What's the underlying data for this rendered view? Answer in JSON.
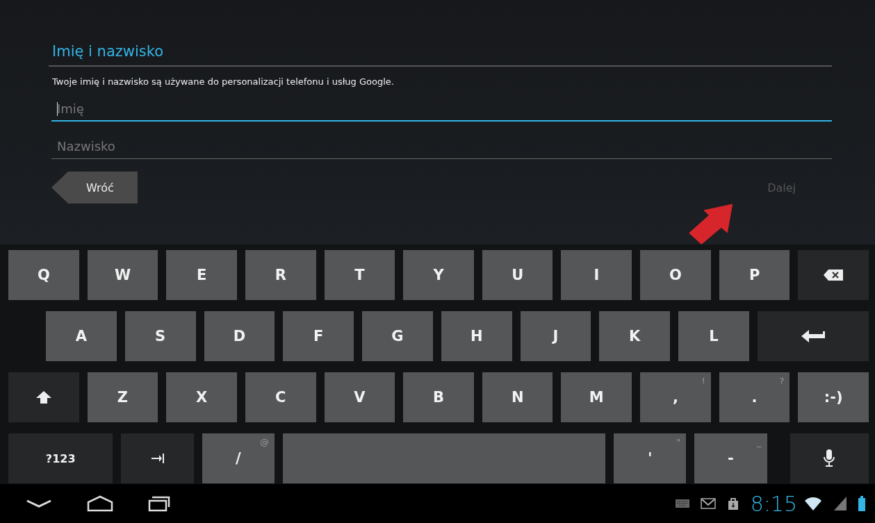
{
  "header": {
    "title": "Imię i nazwisko",
    "description": "Twoje imię i nazwisko są używane do personalizacji telefonu i usług Google."
  },
  "fields": [
    {
      "placeholder": "Imię",
      "focused": true
    },
    {
      "placeholder": "Nazwisko",
      "focused": false
    }
  ],
  "buttons": [
    {
      "label": "Wróć",
      "kind": "back",
      "disabled": false
    },
    {
      "label": "Dalej",
      "kind": "next",
      "disabled": true
    }
  ],
  "keyboard": {
    "rows": [
      [
        {
          "kind": "letter",
          "label": "Q"
        },
        {
          "kind": "letter",
          "label": "W"
        },
        {
          "kind": "letter",
          "label": "E"
        },
        {
          "kind": "letter",
          "label": "R"
        },
        {
          "kind": "letter",
          "label": "T"
        },
        {
          "kind": "letter",
          "label": "Y"
        },
        {
          "kind": "letter",
          "label": "U"
        },
        {
          "kind": "letter",
          "label": "I"
        },
        {
          "kind": "letter",
          "label": "O"
        },
        {
          "kind": "letter",
          "label": "P"
        },
        {
          "kind": "backspace"
        }
      ],
      [
        {
          "kind": "letter",
          "label": "A"
        },
        {
          "kind": "letter",
          "label": "S"
        },
        {
          "kind": "letter",
          "label": "D"
        },
        {
          "kind": "letter",
          "label": "F"
        },
        {
          "kind": "letter",
          "label": "G"
        },
        {
          "kind": "letter",
          "label": "H"
        },
        {
          "kind": "letter",
          "label": "J"
        },
        {
          "kind": "letter",
          "label": "K"
        },
        {
          "kind": "letter",
          "label": "L"
        },
        {
          "kind": "enter"
        }
      ],
      [
        {
          "kind": "shift"
        },
        {
          "kind": "letter",
          "label": "Z"
        },
        {
          "kind": "letter",
          "label": "X"
        },
        {
          "kind": "letter",
          "label": "C"
        },
        {
          "kind": "letter",
          "label": "V"
        },
        {
          "kind": "letter",
          "label": "B"
        },
        {
          "kind": "letter",
          "label": "N"
        },
        {
          "kind": "letter",
          "label": "M"
        },
        {
          "kind": "letter",
          "label": ",",
          "hint": "!"
        },
        {
          "kind": "letter",
          "label": ".",
          "hint": "?"
        },
        {
          "kind": "letter",
          "label": ":-)"
        }
      ],
      [
        {
          "kind": "mode",
          "label": "?123"
        },
        {
          "kind": "tab"
        },
        {
          "kind": "letter",
          "label": "/",
          "hint": "@"
        },
        {
          "kind": "space"
        },
        {
          "kind": "letter",
          "label": "'",
          "hint": "\""
        },
        {
          "kind": "letter",
          "label": "-",
          "hint": "_"
        },
        {
          "kind": "mic"
        }
      ]
    ]
  },
  "status_bar": {
    "time": "8:15"
  }
}
